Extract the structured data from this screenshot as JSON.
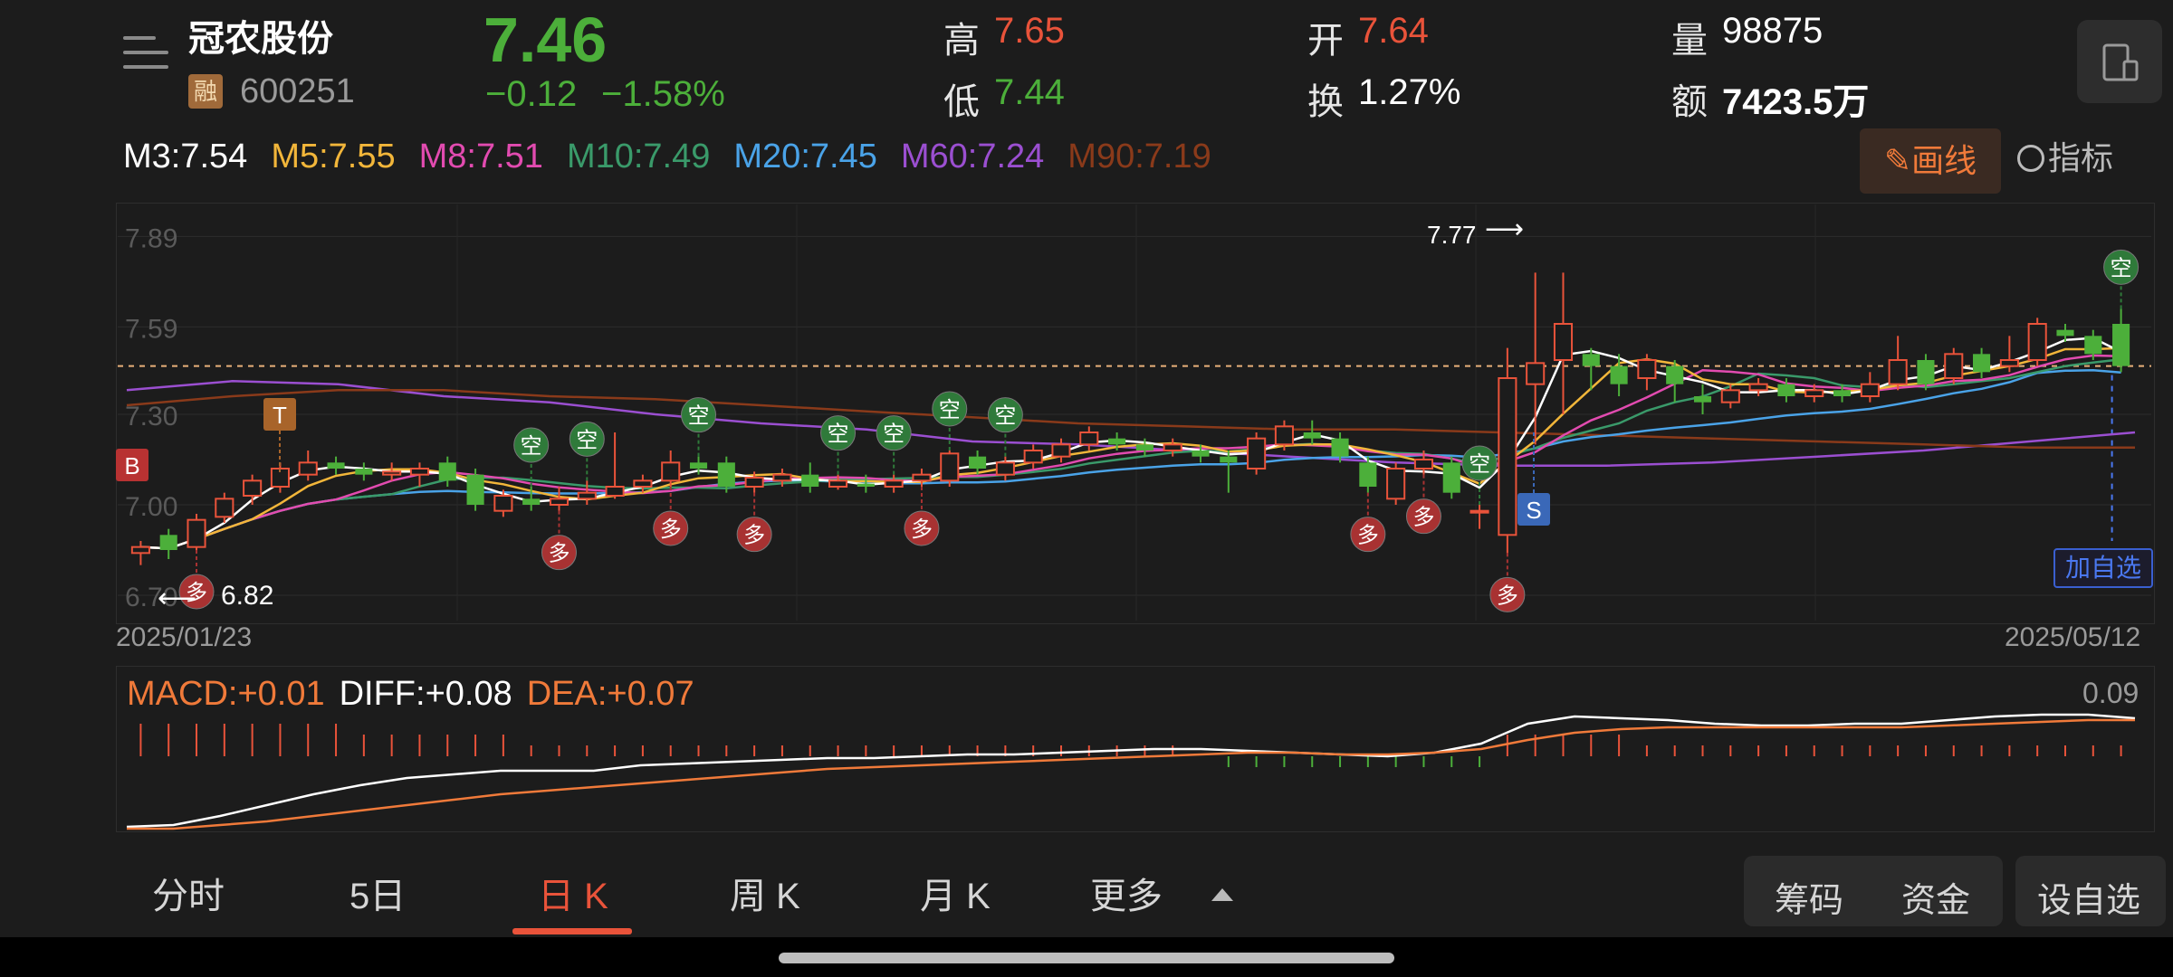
{
  "header": {
    "name": "冠农股份",
    "badge": "融",
    "code": "600251",
    "price": "7.46",
    "change": "−0.12",
    "change_pct": "−1.58%",
    "high_label": "高",
    "high": "7.65",
    "low_label": "低",
    "low": "7.44",
    "open_label": "开",
    "open": "7.64",
    "turnover_label": "换",
    "turnover": "1.27%",
    "volume_label": "量",
    "volume": "98875",
    "amount_label": "额",
    "amount": "7423.5万"
  },
  "ma": [
    {
      "text": "M3:7.54",
      "color": "#ffffff"
    },
    {
      "text": "M5:7.55",
      "color": "#f2b63a"
    },
    {
      "text": "M8:7.51",
      "color": "#e24bb0"
    },
    {
      "text": "M10:7.49",
      "color": "#3a9a6a"
    },
    {
      "text": "M20:7.45",
      "color": "#4aa3e8"
    },
    {
      "text": "M60:7.24",
      "color": "#9b4fd1"
    },
    {
      "text": "M90:7.19",
      "color": "#8a3a1a"
    }
  ],
  "toolbar": {
    "draw_label": "画线",
    "indicator_label": "指标"
  },
  "chart": {
    "y_ticks": [
      "7.89",
      "7.59",
      "7.30",
      "7.00",
      "6.70"
    ],
    "start_date": "2025/01/23",
    "end_date": "2025/05/12",
    "max_label": "7.77",
    "min_label": "6.82",
    "add_fav_label": "加自选",
    "signals": {
      "buy": "B",
      "sell": "S",
      "t": "T",
      "long": "多",
      "short": "空"
    }
  },
  "macd": {
    "macd": "MACD:+0.01",
    "diff": "DIFF:+0.08",
    "dea": "DEA:+0.07",
    "max": "0.09",
    "colors": {
      "macd": "#f07a3a",
      "diff": "#ffffff",
      "dea": "#f07a3a"
    }
  },
  "tabs": [
    "分时",
    "5日",
    "日 K",
    "周 K",
    "月 K",
    "更多"
  ],
  "active_tab": "日 K",
  "right_buttons": [
    "筹码",
    "资金"
  ],
  "add_fav_button": "设自选",
  "icons": [
    "menu-icon",
    "device-icon",
    "pencil-icon",
    "gauge-icon",
    "caret-up-icon"
  ],
  "colors": {
    "up": "#e9533a",
    "down": "#4caf3a",
    "background": "#1c1c1c"
  },
  "chart_data": {
    "type": "candlestick",
    "ylim": [
      6.7,
      7.9
    ],
    "candles": [
      [
        6.84,
        6.86,
        6.8,
        6.88
      ],
      [
        6.9,
        6.85,
        6.82,
        6.92
      ],
      [
        6.86,
        6.95,
        6.85,
        6.97
      ],
      [
        6.96,
        7.02,
        6.94,
        7.04
      ],
      [
        7.03,
        7.08,
        7.0,
        7.1
      ],
      [
        7.06,
        7.12,
        7.04,
        7.14
      ],
      [
        7.1,
        7.14,
        7.08,
        7.18
      ],
      [
        7.14,
        7.12,
        7.1,
        7.16
      ],
      [
        7.12,
        7.1,
        7.08,
        7.14
      ],
      [
        7.1,
        7.11,
        7.08,
        7.14
      ],
      [
        7.1,
        7.12,
        7.06,
        7.14
      ],
      [
        7.14,
        7.08,
        7.06,
        7.16
      ],
      [
        7.1,
        7.0,
        6.98,
        7.12
      ],
      [
        6.98,
        7.03,
        6.96,
        7.05
      ],
      [
        7.02,
        7.0,
        6.98,
        7.06
      ],
      [
        7.0,
        7.02,
        6.98,
        7.06
      ],
      [
        7.02,
        7.04,
        7.0,
        7.08
      ],
      [
        7.03,
        7.06,
        7.02,
        7.24
      ],
      [
        7.06,
        7.08,
        7.04,
        7.1
      ],
      [
        7.08,
        7.14,
        7.06,
        7.18
      ],
      [
        7.14,
        7.12,
        7.1,
        7.16
      ],
      [
        7.14,
        7.06,
        7.04,
        7.16
      ],
      [
        7.06,
        7.09,
        7.04,
        7.11
      ],
      [
        7.08,
        7.1,
        7.06,
        7.12
      ],
      [
        7.1,
        7.06,
        7.04,
        7.14
      ],
      [
        7.06,
        7.08,
        7.05,
        7.1
      ],
      [
        7.07,
        7.06,
        7.04,
        7.1
      ],
      [
        7.06,
        7.08,
        7.04,
        7.1
      ],
      [
        7.08,
        7.1,
        7.06,
        7.12
      ],
      [
        7.08,
        7.17,
        7.06,
        7.18
      ],
      [
        7.16,
        7.12,
        7.1,
        7.18
      ],
      [
        7.1,
        7.14,
        7.08,
        7.16
      ],
      [
        7.14,
        7.18,
        7.12,
        7.2
      ],
      [
        7.16,
        7.2,
        7.14,
        7.22
      ],
      [
        7.2,
        7.24,
        7.18,
        7.26
      ],
      [
        7.22,
        7.2,
        7.18,
        7.24
      ],
      [
        7.2,
        7.18,
        7.16,
        7.22
      ],
      [
        7.18,
        7.2,
        7.16,
        7.22
      ],
      [
        7.18,
        7.16,
        7.14,
        7.2
      ],
      [
        7.16,
        7.14,
        7.04,
        7.18
      ],
      [
        7.12,
        7.22,
        7.1,
        7.24
      ],
      [
        7.2,
        7.26,
        7.18,
        7.28
      ],
      [
        7.24,
        7.22,
        7.2,
        7.28
      ],
      [
        7.22,
        7.16,
        7.14,
        7.24
      ],
      [
        7.14,
        7.06,
        7.04,
        7.16
      ],
      [
        7.02,
        7.12,
        7.0,
        7.14
      ],
      [
        7.12,
        7.15,
        7.1,
        7.18
      ],
      [
        7.14,
        7.04,
        7.02,
        7.16
      ],
      [
        6.98,
        6.98,
        6.92,
        7.0
      ],
      [
        6.9,
        7.42,
        6.84,
        7.52
      ],
      [
        7.4,
        7.47,
        7.2,
        7.77
      ],
      [
        7.48,
        7.6,
        7.3,
        7.77
      ],
      [
        7.5,
        7.46,
        7.38,
        7.52
      ],
      [
        7.46,
        7.4,
        7.36,
        7.5
      ],
      [
        7.42,
        7.48,
        7.38,
        7.5
      ],
      [
        7.46,
        7.4,
        7.34,
        7.48
      ],
      [
        7.36,
        7.34,
        7.3,
        7.4
      ],
      [
        7.34,
        7.38,
        7.32,
        7.4
      ],
      [
        7.38,
        7.4,
        7.36,
        7.42
      ],
      [
        7.4,
        7.36,
        7.34,
        7.42
      ],
      [
        7.36,
        7.38,
        7.34,
        7.4
      ],
      [
        7.38,
        7.36,
        7.34,
        7.4
      ],
      [
        7.36,
        7.4,
        7.34,
        7.44
      ],
      [
        7.4,
        7.48,
        7.38,
        7.56
      ],
      [
        7.48,
        7.4,
        7.38,
        7.5
      ],
      [
        7.42,
        7.5,
        7.4,
        7.52
      ],
      [
        7.5,
        7.44,
        7.42,
        7.52
      ],
      [
        7.46,
        7.48,
        7.44,
        7.56
      ],
      [
        7.48,
        7.6,
        7.46,
        7.62
      ],
      [
        7.58,
        7.56,
        7.54,
        7.6
      ],
      [
        7.56,
        7.5,
        7.48,
        7.58
      ],
      [
        7.6,
        7.46,
        7.44,
        7.65
      ]
    ],
    "macd_hist": [
      0.03,
      0.03,
      0.03,
      0.03,
      0.03,
      0.03,
      0.03,
      0.03,
      0.02,
      0.02,
      0.02,
      0.02,
      0.02,
      0.02,
      0.01,
      0.01,
      0.01,
      0.01,
      0.01,
      0.01,
      0.01,
      0.01,
      0.01,
      0.01,
      0.01,
      0.01,
      0.01,
      0.01,
      0.01,
      0.01,
      0.01,
      0.01,
      0.01,
      0.01,
      0.01,
      0.01,
      0.01,
      0.01,
      0.0,
      -0.01,
      -0.01,
      -0.01,
      -0.01,
      -0.01,
      -0.01,
      -0.01,
      -0.01,
      -0.01,
      -0.01,
      0.02,
      0.02,
      0.02,
      0.02,
      0.02,
      0.01,
      0.01,
      0.01,
      0.01,
      0.01,
      0.01,
      0.01,
      0.01,
      0.01,
      0.01,
      0.01,
      0.01,
      0.01,
      0.01,
      0.01,
      0.01,
      0.01,
      0.01
    ]
  }
}
